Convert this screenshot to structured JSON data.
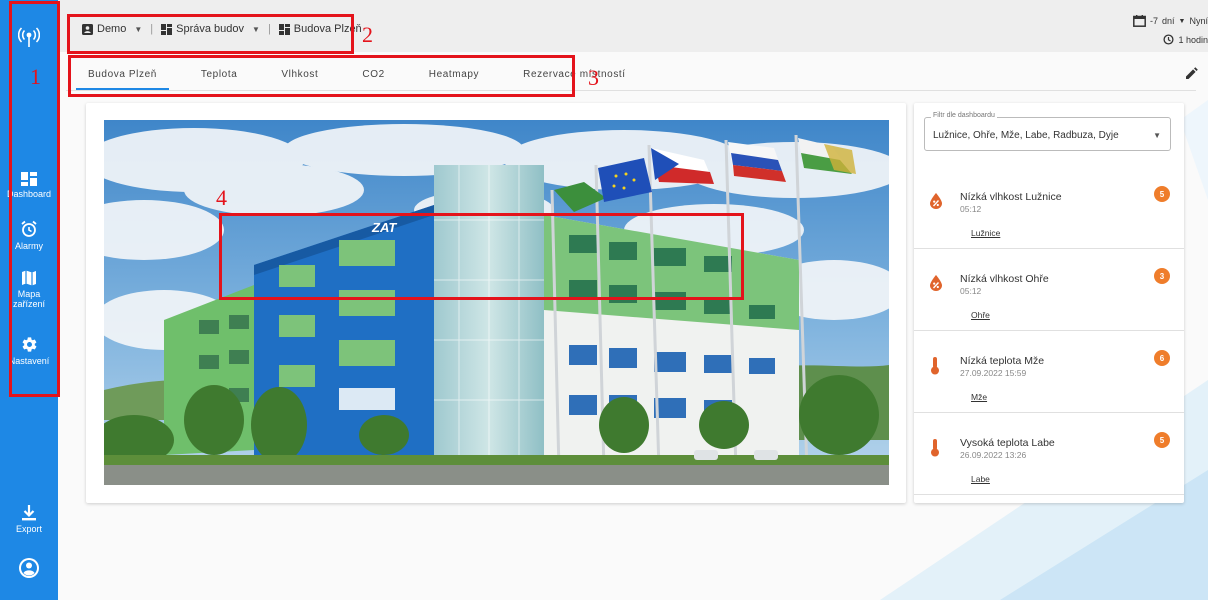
{
  "sidebar": {
    "items": [
      {
        "label": "Dashboard",
        "icon": "dashboard-icon"
      },
      {
        "label": "Alarmy",
        "icon": "alarm-clock-icon"
      },
      {
        "label": "Mapa zařízení",
        "icon": "map-icon"
      },
      {
        "label": "Nastavení",
        "icon": "gear-icon"
      }
    ],
    "export_label": "Export"
  },
  "breadcrumb": {
    "items": [
      "Demo",
      "Správa budov",
      "Budova Plzeň"
    ],
    "separator": "|"
  },
  "daterange": {
    "range": "-7",
    "unit": "dní",
    "now": "Nyní",
    "refresh": "1 hodin"
  },
  "tabs": [
    "Budova Plzeň",
    "Teplota",
    "Vlhkost",
    "CO2",
    "Heatmapy",
    "Rezervace místností"
  ],
  "active_tab": 0,
  "photo": {
    "logo_text": "ZAT"
  },
  "filter": {
    "label": "Filtr dle dashboardu",
    "value": "Lužnice, Ohře, Mže, Labe, Radbuza, Dyje"
  },
  "alarms": [
    {
      "title": "Nízká vlhkost Lužnice",
      "time": "05:12",
      "link": "Lužnice",
      "badge": "5",
      "icon": "humidity-icon"
    },
    {
      "title": "Nízká vlhkost Ohře",
      "time": "05:12",
      "link": "Ohře",
      "badge": "3",
      "icon": "humidity-icon"
    },
    {
      "title": "Nízká teplota Mže",
      "time": "27.09.2022 15:59",
      "link": "Mže",
      "badge": "6",
      "icon": "thermometer-icon"
    },
    {
      "title": "Vysoká teplota Labe",
      "time": "26.09.2022 13:26",
      "link": "Labe",
      "badge": "5",
      "icon": "thermometer-icon"
    }
  ],
  "annotations": [
    "1",
    "2",
    "3",
    "4"
  ],
  "colors": {
    "sidebar": "#1e88e5",
    "accent": "#1e88e5",
    "annotation": "#e4131b",
    "badge": "#ef7d2b",
    "alarm_icon": "#e0642c"
  }
}
